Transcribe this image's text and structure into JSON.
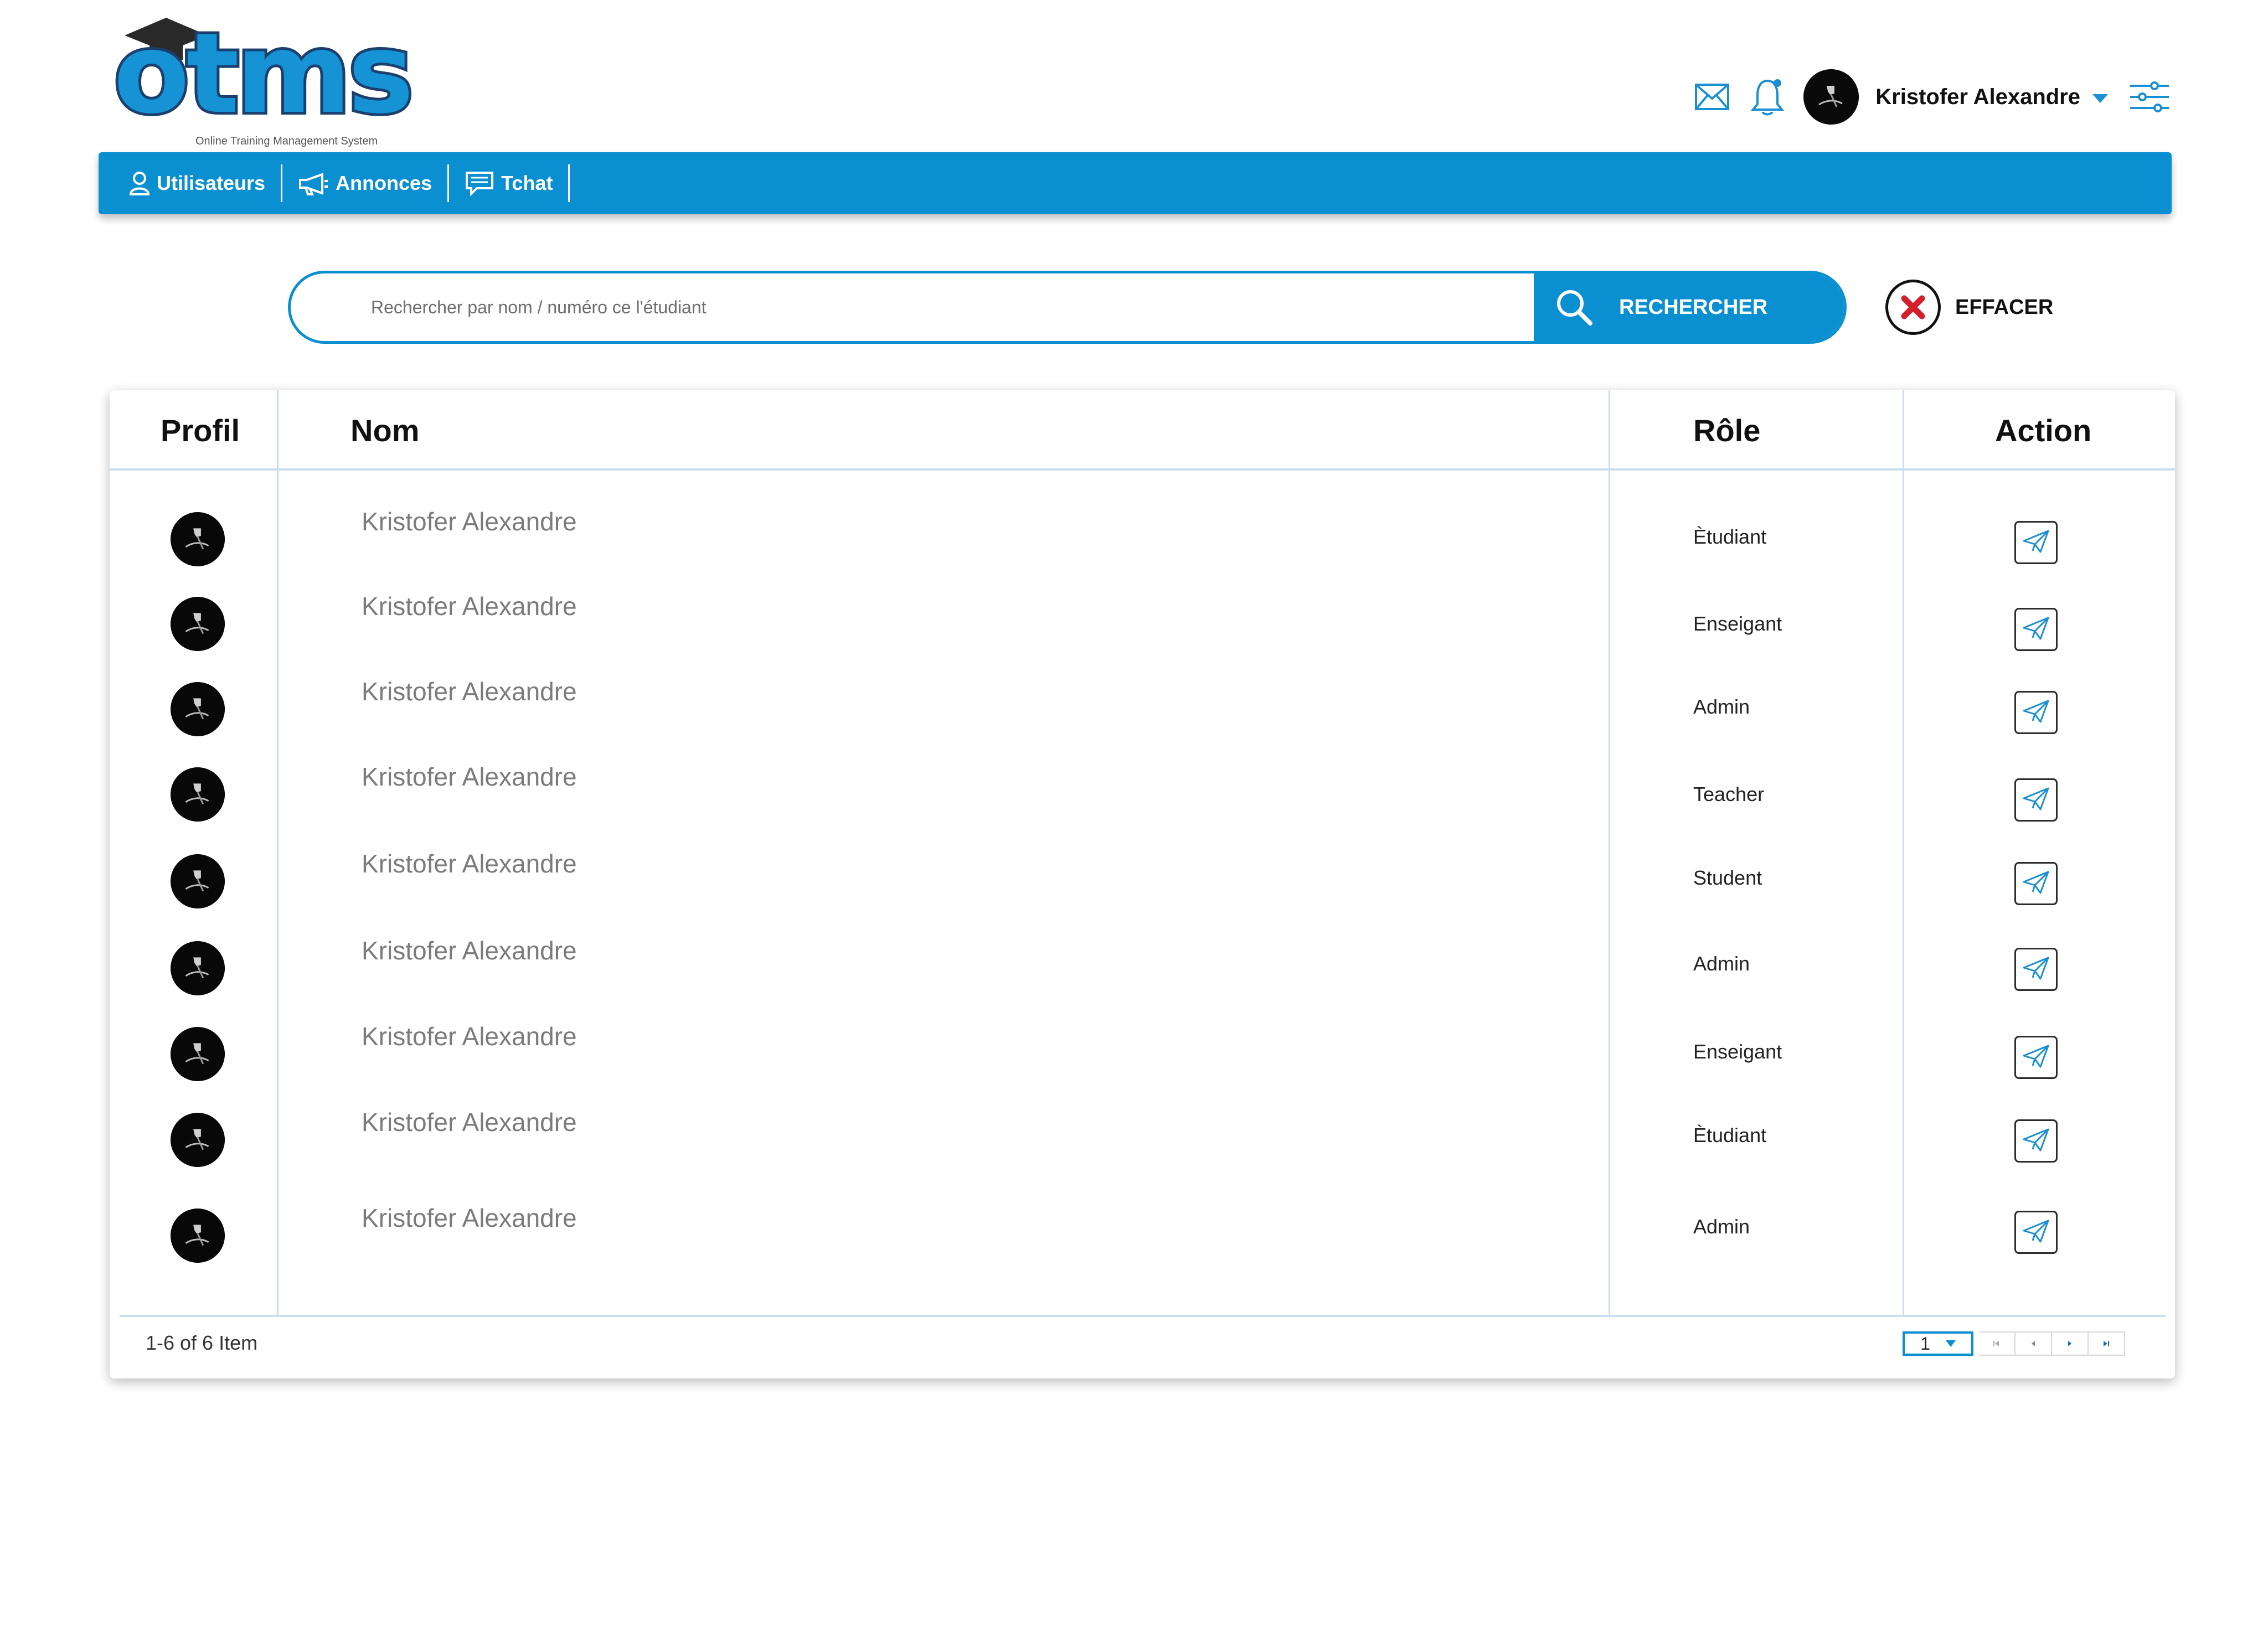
{
  "brand": {
    "logo_text": "otms",
    "tagline": "Online Training Management System",
    "primary_color": "#0a8fd1",
    "logo_outline_color": "#1b3f6e"
  },
  "topbar": {
    "icons": [
      "mail-icon",
      "bell-icon",
      "user-avatar",
      "chevron-down-icon",
      "sliders-icon"
    ],
    "user_name": "Kristofer Alexandre"
  },
  "nav": {
    "items": [
      {
        "label": "Utilisateurs",
        "icon": "user-icon"
      },
      {
        "label": "Annonces",
        "icon": "megaphone-icon"
      },
      {
        "label": "Tchat",
        "icon": "chat-icon"
      }
    ]
  },
  "search": {
    "placeholder": "Rechercher par nom / numéro ce l'étudiant",
    "value": "",
    "button_label": "RECHERCHER",
    "clear_label": "EFFACER"
  },
  "table": {
    "columns": [
      "Profil",
      "Nom",
      "Rôle",
      "Action"
    ],
    "rows": [
      {
        "name": "Kristofer Alexandre",
        "role": "Ètudiant"
      },
      {
        "name": "Kristofer Alexandre",
        "role": "Enseigant"
      },
      {
        "name": "Kristofer Alexandre",
        "role": "Admin"
      },
      {
        "name": "Kristofer Alexandre",
        "role": "Teacher"
      },
      {
        "name": "Kristofer Alexandre",
        "role": "Student"
      },
      {
        "name": "Kristofer Alexandre",
        "role": "Admin"
      },
      {
        "name": "Kristofer Alexandre",
        "role": "Enseigant"
      },
      {
        "name": "Kristofer Alexandre",
        "role": "Ètudiant"
      },
      {
        "name": "Kristofer Alexandre",
        "role": "Admin"
      }
    ],
    "action_icon": "send-icon",
    "footer_count": "1-6 of 6 Item",
    "page": "1",
    "pager_icons": [
      "first-page-icon",
      "prev-page-icon",
      "next-page-icon",
      "last-page-icon"
    ]
  }
}
